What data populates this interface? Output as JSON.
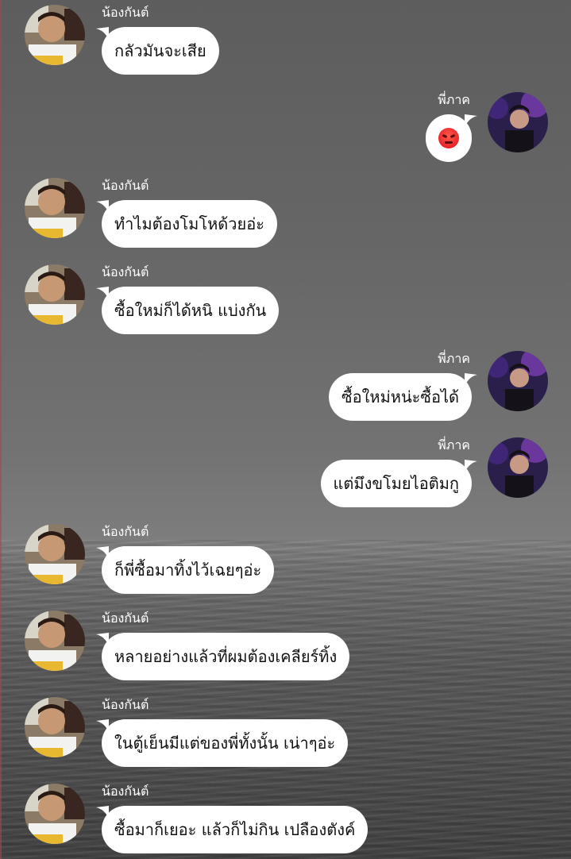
{
  "contacts": {
    "friend": "น้องกันต์",
    "me": "พี่ภาค"
  },
  "messages": [
    {
      "sender": "น้องกันต์",
      "text": "กลัวมันจะเสีย"
    },
    {
      "sender": "พี่ภาค",
      "emoji": "angry-face"
    },
    {
      "sender": "น้องกันต์",
      "text": "ทำไมต้องโมโหด้วยอ่ะ"
    },
    {
      "sender": "น้องกันต์",
      "text": "ซื้อใหม่ก็ได้หนิ แบ่งกัน"
    },
    {
      "sender": "พี่ภาค",
      "text": "ซื้อใหม่หน่ะซื้อได้"
    },
    {
      "sender": "พี่ภาค",
      "text": "แต่มึงขโมยไอติมกู"
    },
    {
      "sender": "น้องกันต์",
      "text": "ก็พี่ซื้อมาทิ้งไว้เฉยๆอ่ะ"
    },
    {
      "sender": "น้องกันต์",
      "text": "หลายอย่างแล้วที่ผมต้องเคลียร์ทิ้ง"
    },
    {
      "sender": "น้องกันต์",
      "text": "ในตู้เย็นมีแต่ของพี่ทั้งนั้น เน่าๆอ่ะ"
    },
    {
      "sender": "น้องกันต์",
      "text": "ซื้อมาก็เยอะ แล้วก็ไม่กิน เปลืองตังค์"
    }
  ],
  "colors": {
    "bubble": "#ffffff",
    "name_text": "#ffffff",
    "background": "#6a6a6a"
  }
}
